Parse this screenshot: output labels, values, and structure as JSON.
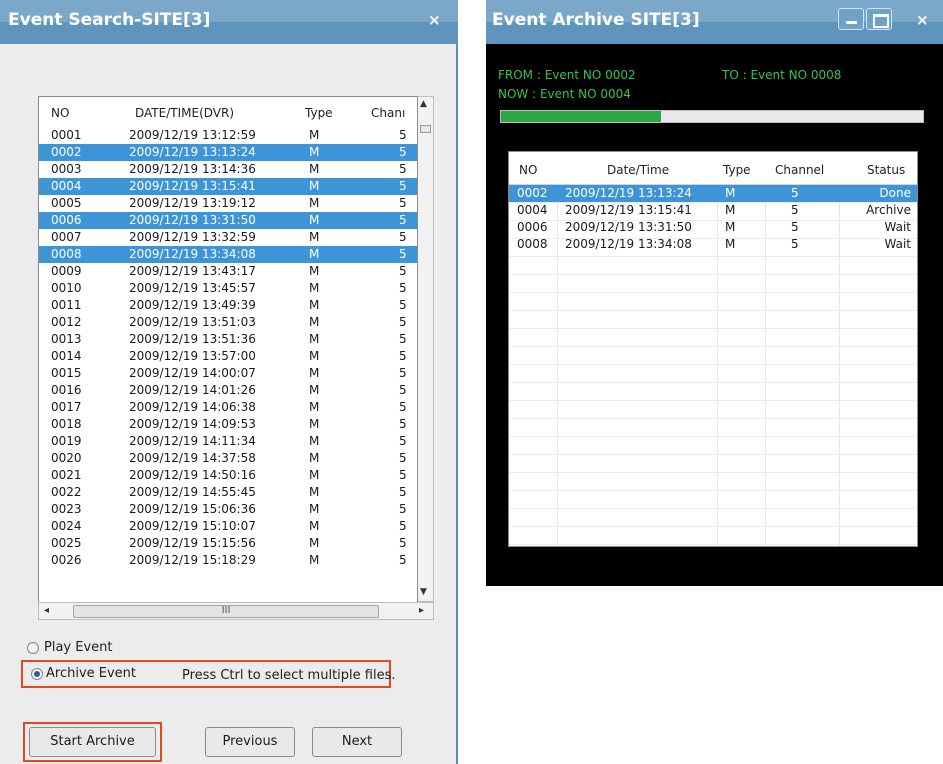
{
  "event_search": {
    "title": "Event Search-SITE[3]",
    "close_label": "×",
    "columns": {
      "no": "NO",
      "datetime": "DATE/TIME(DVR)",
      "type": "Type",
      "channel": "Chanı"
    },
    "rows": [
      {
        "no": "0001",
        "datetime": "2009/12/19 13:12:59",
        "type": "M",
        "channel": "5",
        "selected": false
      },
      {
        "no": "0002",
        "datetime": "2009/12/19 13:13:24",
        "type": "M",
        "channel": "5",
        "selected": true
      },
      {
        "no": "0003",
        "datetime": "2009/12/19 13:14:36",
        "type": "M",
        "channel": "5",
        "selected": false
      },
      {
        "no": "0004",
        "datetime": "2009/12/19 13:15:41",
        "type": "M",
        "channel": "5",
        "selected": true
      },
      {
        "no": "0005",
        "datetime": "2009/12/19 13:19:12",
        "type": "M",
        "channel": "5",
        "selected": false
      },
      {
        "no": "0006",
        "datetime": "2009/12/19 13:31:50",
        "type": "M",
        "channel": "5",
        "selected": true
      },
      {
        "no": "0007",
        "datetime": "2009/12/19 13:32:59",
        "type": "M",
        "channel": "5",
        "selected": false
      },
      {
        "no": "0008",
        "datetime": "2009/12/19 13:34:08",
        "type": "M",
        "channel": "5",
        "selected": true
      },
      {
        "no": "0009",
        "datetime": "2009/12/19 13:43:17",
        "type": "M",
        "channel": "5",
        "selected": false
      },
      {
        "no": "0010",
        "datetime": "2009/12/19 13:45:57",
        "type": "M",
        "channel": "5",
        "selected": false
      },
      {
        "no": "0011",
        "datetime": "2009/12/19 13:49:39",
        "type": "M",
        "channel": "5",
        "selected": false
      },
      {
        "no": "0012",
        "datetime": "2009/12/19 13:51:03",
        "type": "M",
        "channel": "5",
        "selected": false
      },
      {
        "no": "0013",
        "datetime": "2009/12/19 13:51:36",
        "type": "M",
        "channel": "5",
        "selected": false
      },
      {
        "no": "0014",
        "datetime": "2009/12/19 13:57:00",
        "type": "M",
        "channel": "5",
        "selected": false
      },
      {
        "no": "0015",
        "datetime": "2009/12/19 14:00:07",
        "type": "M",
        "channel": "5",
        "selected": false
      },
      {
        "no": "0016",
        "datetime": "2009/12/19 14:01:26",
        "type": "M",
        "channel": "5",
        "selected": false
      },
      {
        "no": "0017",
        "datetime": "2009/12/19 14:06:38",
        "type": "M",
        "channel": "5",
        "selected": false
      },
      {
        "no": "0018",
        "datetime": "2009/12/19 14:09:53",
        "type": "M",
        "channel": "5",
        "selected": false
      },
      {
        "no": "0019",
        "datetime": "2009/12/19 14:11:34",
        "type": "M",
        "channel": "5",
        "selected": false
      },
      {
        "no": "0020",
        "datetime": "2009/12/19 14:37:58",
        "type": "M",
        "channel": "5",
        "selected": false
      },
      {
        "no": "0021",
        "datetime": "2009/12/19 14:50:16",
        "type": "M",
        "channel": "5",
        "selected": false
      },
      {
        "no": "0022",
        "datetime": "2009/12/19 14:55:45",
        "type": "M",
        "channel": "5",
        "selected": false
      },
      {
        "no": "0023",
        "datetime": "2009/12/19 15:06:36",
        "type": "M",
        "channel": "5",
        "selected": false
      },
      {
        "no": "0024",
        "datetime": "2009/12/19 15:10:07",
        "type": "M",
        "channel": "5",
        "selected": false
      },
      {
        "no": "0025",
        "datetime": "2009/12/19 15:15:56",
        "type": "M",
        "channel": "5",
        "selected": false
      },
      {
        "no": "0026",
        "datetime": "2009/12/19 15:18:29",
        "type": "M",
        "channel": "5",
        "selected": false
      }
    ],
    "hscroll_thumb_glyph": "III",
    "options": {
      "play_event": "Play Event",
      "archive_event": "Archive Event",
      "selected": "archive_event"
    },
    "hint": "Press Ctrl to select multiple files.",
    "buttons": {
      "start_archive": "Start Archive",
      "previous": "Previous",
      "next": "Next"
    }
  },
  "event_archive": {
    "title": "Event Archive  SITE[3]",
    "close_label": "×",
    "from_label": "FROM : Event NO 0002",
    "to_label": "TO : Event NO 0008",
    "now_label": "NOW :  Event NO 0004",
    "progress_fraction": 0.38,
    "columns": {
      "no": "NO",
      "datetime": "Date/Time",
      "type": "Type",
      "channel": "Channel",
      "status": "Status"
    },
    "rows": [
      {
        "no": "0002",
        "datetime": "2009/12/19 13:13:24",
        "type": "M",
        "channel": "5",
        "status": "Done",
        "selected": true
      },
      {
        "no": "0004",
        "datetime": "2009/12/19 13:15:41",
        "type": "M",
        "channel": "5",
        "status": "Archive",
        "selected": false
      },
      {
        "no": "0006",
        "datetime": "2009/12/19 13:31:50",
        "type": "M",
        "channel": "5",
        "status": "Wait",
        "selected": false
      },
      {
        "no": "0008",
        "datetime": "2009/12/19 13:34:08",
        "type": "M",
        "channel": "5",
        "status": "Wait",
        "selected": false
      }
    ]
  },
  "colors": {
    "titlebar": "#5f95bd",
    "selection": "#3d95d8",
    "highlight_box": "#e04a1f",
    "status_text": "#3ac24a",
    "progress_fill": "#2aa743"
  }
}
